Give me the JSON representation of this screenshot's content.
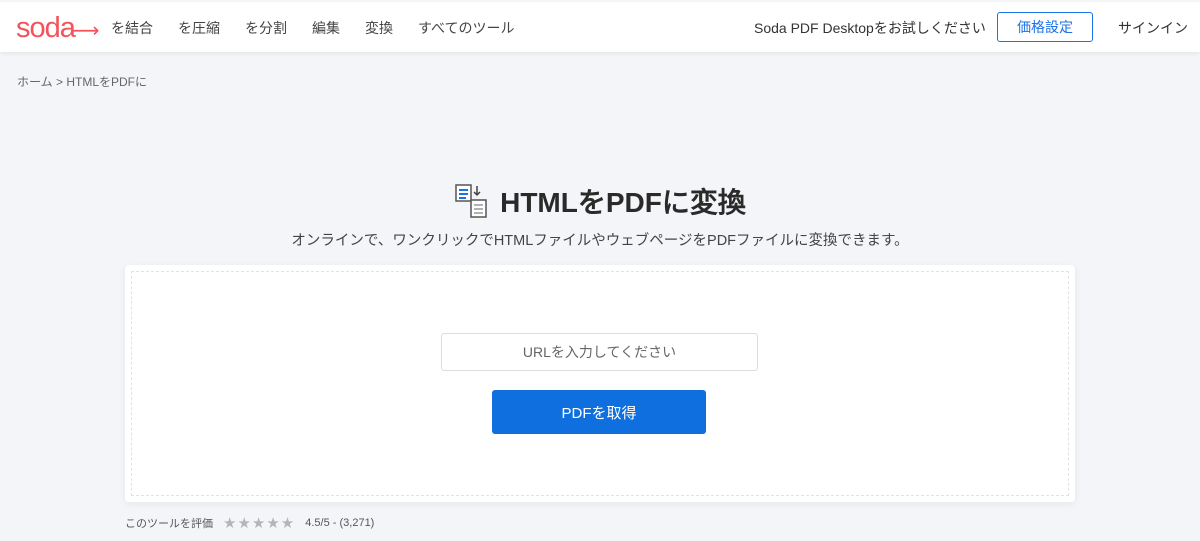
{
  "header": {
    "logo": "soda",
    "nav": [
      "を結合",
      "を圧縮",
      "を分割",
      "編集",
      "変換",
      "すべてのツール"
    ],
    "try_desktop": "Soda PDF Desktopをお試しください",
    "pricing": "価格設定",
    "signin": "サインイン"
  },
  "breadcrumb": {
    "home": "ホーム",
    "sep": ">",
    "current": "HTMLをPDFに"
  },
  "main": {
    "title": "HTMLをPDFに変換",
    "subtitle": "オンラインで、ワンクリックでHTMLファイルやウェブページをPDFファイルに変換できます。",
    "url_placeholder": "URLを入力してください",
    "submit": "PDFを取得"
  },
  "rating": {
    "label": "このツールを評価",
    "value": 4.5,
    "text": "4.5/5 - (3,271)"
  },
  "colors": {
    "brand": "#f4535a",
    "accent": "#0f6fde"
  }
}
